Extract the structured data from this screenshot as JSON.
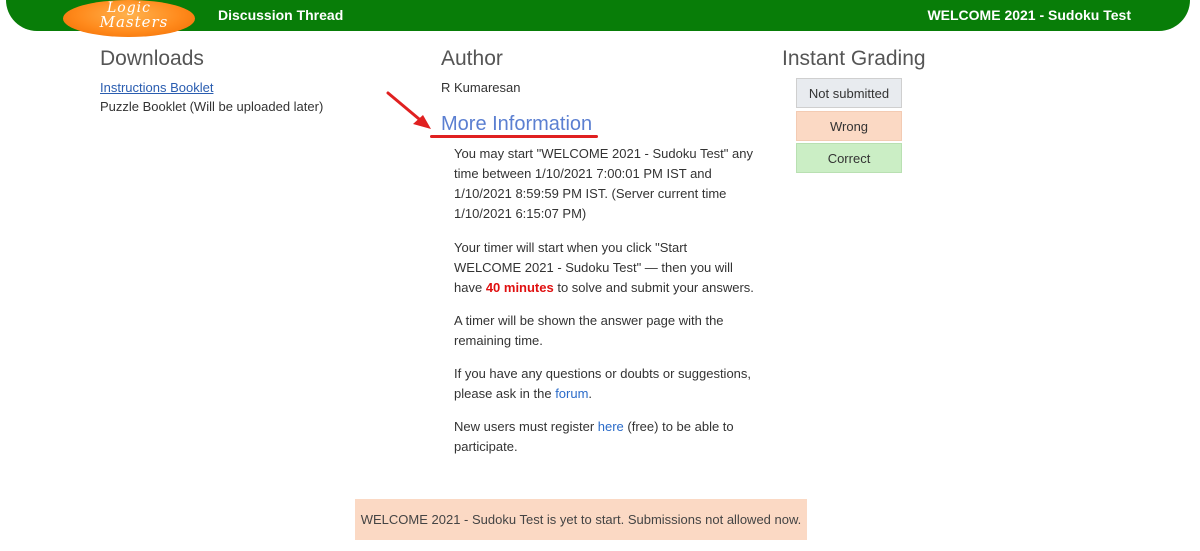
{
  "header": {
    "logo_line1": "Logic",
    "logo_line2": "Masters",
    "nav_link": "Discussion Thread",
    "contest_title": "WELCOME 2021 - Sudoku Test"
  },
  "downloads": {
    "heading": "Downloads",
    "instructions_link": "Instructions Booklet",
    "puzzle_booklet": "Puzzle Booklet (Will be uploaded later)"
  },
  "author": {
    "heading": "Author",
    "name": "R Kumaresan"
  },
  "more_info": {
    "heading": "More Information",
    "p1": "You may start \"WELCOME 2021 - Sudoku Test\" any time between 1/10/2021 7:00:01 PM IST and 1/10/2021 8:59:59 PM IST. (Server current time 1/10/2021 6:15:07 PM)",
    "p2_pre": "Your timer will start when you click \"Start WELCOME 2021 - Sudoku Test\" — then you will have ",
    "p2_bold": "40 minutes",
    "p2_post": " to solve and submit your answers.",
    "p3": "A timer will be shown the answer page with the remaining time.",
    "p4_pre": "If you have any questions or doubts or suggestions, please ask in the ",
    "p4_link": "forum",
    "p4_post": ".",
    "p5_pre": "New users must register ",
    "p5_link": "here",
    "p5_post": " (free) to be able to participate."
  },
  "grading": {
    "heading": "Instant Grading",
    "not_submitted": "Not submitted",
    "wrong": "Wrong",
    "correct": "Correct"
  },
  "status_message": "WELCOME 2021 - Sudoku Test is yet to start. Submissions not allowed now.",
  "colors": {
    "header_green": "#087d08",
    "wrong_bg": "#fbd9c4",
    "correct_bg": "#cbeec5",
    "not_submitted_bg": "#e8ebef",
    "highlight_red": "#e01010",
    "link_blue": "#2a6bc9"
  }
}
